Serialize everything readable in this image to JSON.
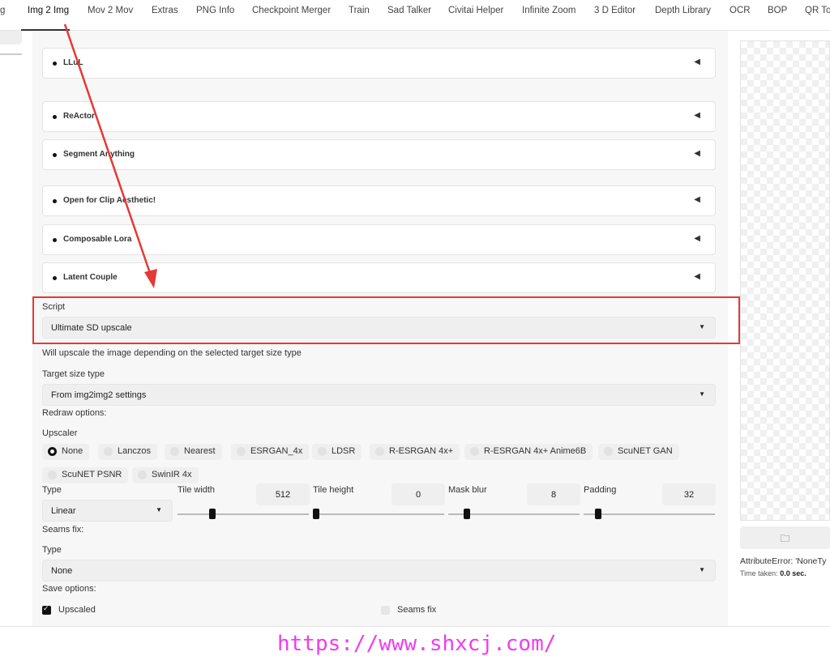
{
  "tabs": [
    "g",
    "Img 2 Img",
    "Mov 2 Mov",
    "Extras",
    "PNG Info",
    "Checkpoint Merger",
    "Train",
    "Sad Talker",
    "Civitai Helper",
    "Infinite Zoom",
    "3 D Editor",
    "Depth Library",
    "OCR",
    "BOP",
    "QR To"
  ],
  "active_tab": "Img 2 Img",
  "accordions": [
    "LLuL",
    "ReActor",
    "Segment Anything",
    "Open for Clip Aesthetic!",
    "Composable Lora",
    "Latent Couple"
  ],
  "script": {
    "label": "Script",
    "value": "Ultimate SD upscale"
  },
  "description": "Will upscale the image depending on the selected target size type",
  "target_size": {
    "label": "Target size type",
    "value": "From img2img2 settings"
  },
  "redraw_label": "Redraw options:",
  "upscaler": {
    "label": "Upscaler",
    "options": [
      "None",
      "Lanczos",
      "Nearest",
      "ESRGAN_4x",
      "LDSR",
      "R-ESRGAN 4x+",
      "R-ESRGAN 4x+ Anime6B",
      "ScuNET GAN",
      "ScuNET PSNR",
      "SwinIR 4x"
    ],
    "selected": "None"
  },
  "redraw_type": {
    "label": "Type",
    "value": "Linear"
  },
  "sliders": [
    {
      "label": "Tile width",
      "value": "512",
      "fraction": 0.25
    },
    {
      "label": "Tile height",
      "value": "0",
      "fraction": 0.0
    },
    {
      "label": "Mask blur",
      "value": "8",
      "fraction": 0.125
    },
    {
      "label": "Padding",
      "value": "32",
      "fraction": 0.09
    }
  ],
  "seams": {
    "section": "Seams fix:",
    "label": "Type",
    "value": "None"
  },
  "save": {
    "label": "Save options:",
    "upscaled": "Upscaled",
    "upscaled_checked": true,
    "seams_fix": "Seams fix",
    "seams_fix_checked": false
  },
  "output": {
    "error": "AttributeError: 'NoneTy",
    "time_label": "Time taken:",
    "time_value": "0.0 sec."
  },
  "watermark": "https://www.shxcj.com/",
  "colors": {
    "highlight": "#e53935",
    "watermark": "#f03cf0"
  }
}
